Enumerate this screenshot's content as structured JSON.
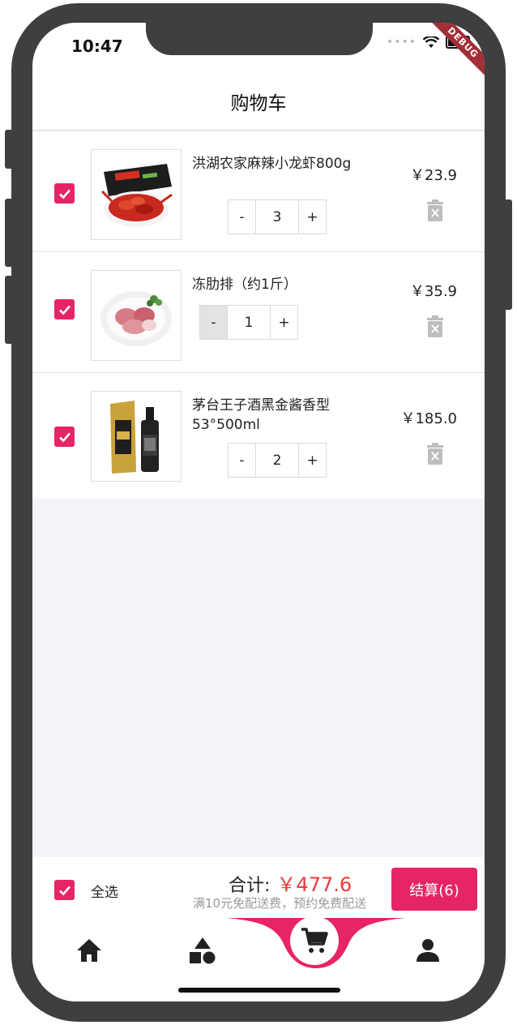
{
  "status_bar": {
    "time": "10:47",
    "debug": "DEBUG"
  },
  "header": {
    "title": "购物车"
  },
  "cart_items": [
    {
      "name": "洪湖农家麻辣小龙虾800g",
      "quantity": "3",
      "price": "￥23.9",
      "checked": true,
      "minus": "-",
      "plus": "+"
    },
    {
      "name": "冻肋排（约1斤）",
      "quantity": "1",
      "price": "￥35.9",
      "checked": true,
      "minus": "-",
      "plus": "+"
    },
    {
      "name": "茅台王子酒黑金酱香型53°500ml",
      "quantity": "2",
      "price": "￥185.0",
      "checked": true,
      "minus": "-",
      "plus": "+"
    }
  ],
  "footer": {
    "select_all_label": "全选",
    "total_label": "合计:",
    "total_value": "￥477.6",
    "delivery_note": "满10元免配送费，预约免费配送",
    "checkout_label": "结算(6)"
  },
  "colors": {
    "accent": "#e72564",
    "price_red": "#ee3a3a",
    "background_gray": "#f3f4f8"
  },
  "nav": {
    "items": [
      {
        "icon": "home-icon"
      },
      {
        "icon": "category-icon"
      },
      {
        "icon": "cart-icon",
        "active": true
      },
      {
        "icon": "profile-icon"
      }
    ]
  }
}
